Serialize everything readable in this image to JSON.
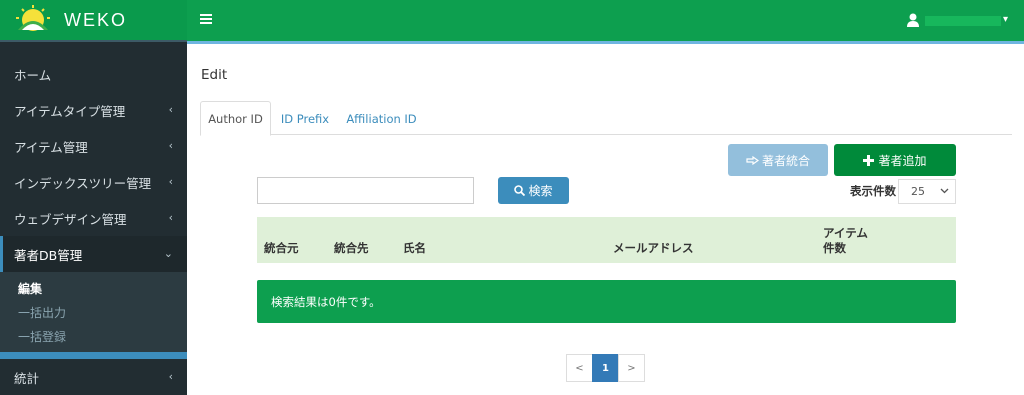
{
  "brand": {
    "logo_text": "WEKO",
    "color": "#0a9a4c"
  },
  "topbar": {
    "menu_icon": "hamburger-icon",
    "user_icon": "user-icon",
    "user_caret": "▾"
  },
  "nav": {
    "items": [
      {
        "label": "ホーム",
        "chevron": ""
      },
      {
        "label": "アイテムタイプ管理",
        "chevron": "‹"
      },
      {
        "label": "アイテム管理",
        "chevron": "‹"
      },
      {
        "label": "インデックスツリー管理",
        "chevron": "‹"
      },
      {
        "label": "ウェブデザイン管理",
        "chevron": "‹"
      },
      {
        "label": "著者DB管理",
        "chevron": "⌄"
      }
    ],
    "submenu": [
      "編集",
      "一括出力",
      "一括登録"
    ],
    "after": [
      {
        "label": "統計",
        "chevron": "‹"
      }
    ]
  },
  "page": {
    "title": "Edit"
  },
  "tabs": [
    "Author ID",
    "ID Prefix",
    "Affiliation ID"
  ],
  "actions": {
    "merge_label": "著者統合",
    "add_label": "著者追加",
    "search_label": "検索"
  },
  "search": {
    "value": "",
    "placeholder": ""
  },
  "display_count": {
    "label": "表示件数",
    "value": "25"
  },
  "table": {
    "headers": [
      "統合元",
      "統合先",
      "氏名",
      "メールアドレス",
      "アイテム",
      "件数"
    ]
  },
  "result_message": "検索結果は0件です。",
  "pagination": {
    "prev": "<",
    "current": "1",
    "next": ">"
  }
}
